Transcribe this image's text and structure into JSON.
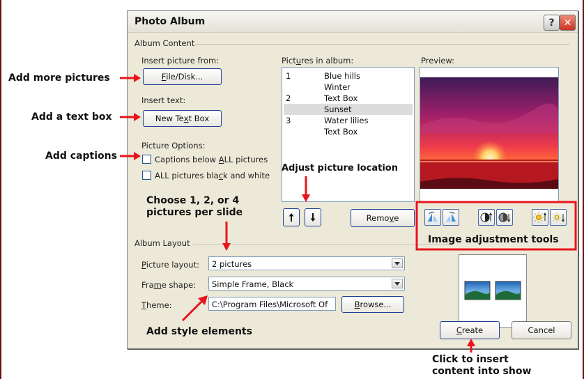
{
  "dialog": {
    "title": "Photo Album",
    "help_glyph": "?",
    "close_glyph": "✕"
  },
  "album_content": {
    "group_label": "Album Content",
    "insert_picture_label": "Insert picture from:",
    "file_disk_button": {
      "pre": "",
      "u": "F",
      "post": "ile/Disk..."
    },
    "insert_text_label": "Insert text:",
    "new_text_box_button": {
      "pre": "New Te",
      "u": "x",
      "post": "t Box"
    },
    "picture_options_label": "Picture Options:",
    "captions_option": {
      "pre": "Captions below ",
      "u": "A",
      "post": "LL pictures",
      "checked": false
    },
    "bw_option": {
      "pre": "ALL pictures bla",
      "u": "c",
      "post": "k and white",
      "checked": false
    },
    "pictures_in_album_label": "Pictures in album:",
    "pictures_in_album_access": {
      "pre": "Pict",
      "u": "u",
      "post": "res in album:"
    },
    "pictures": [
      {
        "num": "1",
        "name": "Blue hills",
        "selected": false
      },
      {
        "num": "",
        "name": "Winter",
        "selected": false
      },
      {
        "num": "2",
        "name": "Text Box",
        "selected": false
      },
      {
        "num": "",
        "name": "Sunset",
        "selected": true
      },
      {
        "num": "3",
        "name": "Water lilies",
        "selected": false
      },
      {
        "num": "",
        "name": "Text Box",
        "selected": false
      }
    ],
    "move_up_glyph": "🠕",
    "move_down_glyph": "🠗",
    "remove_button": {
      "pre": "Remo",
      "u": "v",
      "post": "e"
    },
    "preview_label": "Preview:"
  },
  "image_tools": [
    {
      "name": "rotate-left-icon"
    },
    {
      "name": "rotate-right-icon"
    },
    {
      "name": "contrast-up-icon"
    },
    {
      "name": "contrast-down-icon"
    },
    {
      "name": "brightness-up-icon"
    },
    {
      "name": "brightness-down-icon"
    }
  ],
  "album_layout": {
    "group_label": "Album Layout",
    "picture_layout_label": {
      "pre": "",
      "u": "P",
      "post": "icture layout:"
    },
    "picture_layout_value": "2 pictures",
    "frame_shape_label": {
      "pre": "Fra",
      "u": "m",
      "post": "e shape:"
    },
    "frame_shape_value": "Simple Frame, Black",
    "theme_label": {
      "pre": "",
      "u": "T",
      "post": "heme:"
    },
    "theme_value": "C:\\Program Files\\Microsoft Of",
    "browse_button": {
      "pre": "",
      "u": "B",
      "post": "rowse..."
    }
  },
  "footer": {
    "create_button": {
      "pre": "",
      "u": "C",
      "post": "reate"
    },
    "cancel_button": "Cancel"
  },
  "annotations": {
    "add_more_pictures": "Add more pictures",
    "add_text_box": "Add a text box",
    "add_captions": "Add captions",
    "adjust_location": "Adjust picture location",
    "choose_layout_line1": "Choose 1, 2, or 4",
    "choose_layout_line2": "pictures per slide",
    "image_adjustment_tools": "Image adjustment tools",
    "add_style_elements": "Add style elements",
    "click_insert_line1": "Click to insert",
    "click_insert_line2": "content into show"
  },
  "colors": {
    "annotation_red": "#e8141b",
    "dialog_bg": "#ece9d8",
    "accent_border": "#1c3f94"
  }
}
